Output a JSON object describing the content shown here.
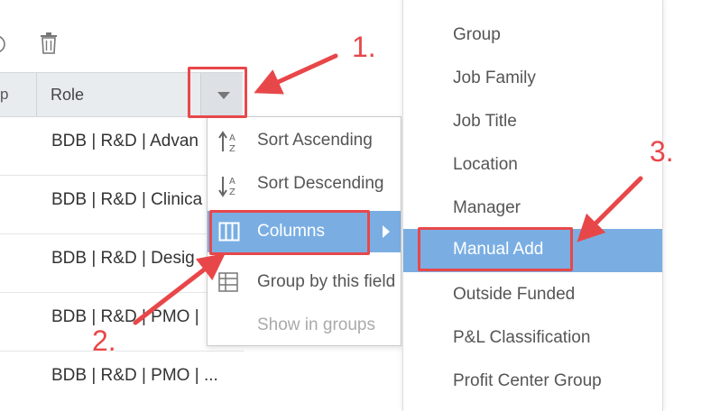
{
  "toolbar": {
    "icons": [
      "circle-minus-icon",
      "trash-icon"
    ]
  },
  "header": {
    "prev_col_fragment": "p",
    "role_label": "Role"
  },
  "rows": [
    {
      "text": "BDB | R&D | Advan"
    },
    {
      "text": "BDB | R&D | Clinica"
    },
    {
      "text": "BDB | R&D | Desig"
    },
    {
      "text": "BDB | R&D | PMO |"
    },
    {
      "text": "BDB | R&D | PMO | ..."
    }
  ],
  "column_menu": {
    "items": [
      {
        "label": "Sort Ascending",
        "icon": "sort-ascending-icon"
      },
      {
        "label": "Sort Descending",
        "icon": "sort-descending-icon"
      },
      {
        "label": "Columns",
        "icon": "columns-icon"
      },
      {
        "label": "Group by this field",
        "icon": "group-by-icon"
      },
      {
        "label": "Show in groups",
        "icon": ""
      }
    ]
  },
  "columns_submenu": {
    "items": [
      {
        "label": "Group"
      },
      {
        "label": "Job Family"
      },
      {
        "label": "Job Title"
      },
      {
        "label": "Location"
      },
      {
        "label": "Manager"
      },
      {
        "label": "Manual Add"
      },
      {
        "label": "Outside Funded"
      },
      {
        "label": "P&L Classification"
      },
      {
        "label": "Profit Center Group"
      }
    ]
  },
  "annotations": {
    "step1": "1.",
    "step2": "2.",
    "step3": "3."
  },
  "colors": {
    "highlight": "#7aaee3",
    "annotation": "#e8474a"
  }
}
